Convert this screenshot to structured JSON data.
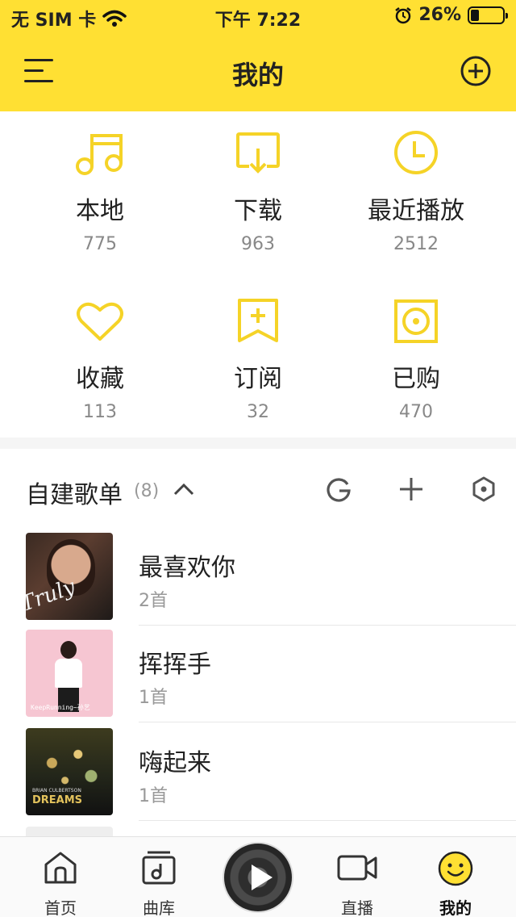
{
  "status_bar": {
    "carrier": "无 SIM 卡",
    "time": "下午 7:22",
    "battery": "26%",
    "battery_level": 0.26
  },
  "header": {
    "title": "我的"
  },
  "grid": [
    {
      "label": "本地",
      "count": "775",
      "icon": "music-note-icon"
    },
    {
      "label": "下载",
      "count": "963",
      "icon": "download-icon"
    },
    {
      "label": "最近播放",
      "count": "2512",
      "icon": "clock-icon"
    },
    {
      "label": "收藏",
      "count": "113",
      "icon": "heart-icon"
    },
    {
      "label": "订阅",
      "count": "32",
      "icon": "bookmark-plus-icon"
    },
    {
      "label": "已购",
      "count": "470",
      "icon": "purchased-disc-icon"
    }
  ],
  "playlists_section": {
    "title": "自建歌单",
    "count": "(8)",
    "items": [
      {
        "name": "最喜欢你",
        "sub": "2首"
      },
      {
        "name": "挥挥手",
        "sub": "1首"
      },
      {
        "name": "嗨起来",
        "sub": "1首"
      }
    ]
  },
  "covers": {
    "cover1_text": "Truly",
    "cover2_text": "KeepRunning~孙艺",
    "cover3_artist": "BRIAN CULBERTSON",
    "cover3_title": "DREAMS"
  },
  "tabbar": {
    "items": [
      {
        "label": "首页"
      },
      {
        "label": "曲库"
      },
      {
        "label": "直播"
      },
      {
        "label": "我的"
      }
    ]
  },
  "colors": {
    "accent": "#FFE033",
    "icon_yellow": "#F5D327"
  }
}
